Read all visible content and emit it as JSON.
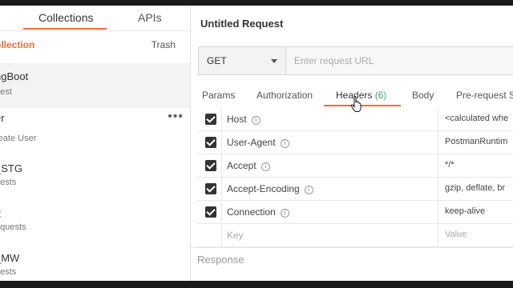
{
  "sidebar": {
    "tabs": [
      {
        "label": "Collections",
        "active": true
      },
      {
        "label": "APIs",
        "active": false
      }
    ],
    "new_collection_label": "ollection",
    "trash_label": "Trash",
    "items": [
      {
        "name": "ngBoot",
        "sub": "uest",
        "active": true
      },
      {
        "name": "er",
        "sub": "reate User",
        "active": false,
        "menu": "•••"
      },
      {
        "name": "_STG",
        "sub": "uests",
        "active": false
      },
      {
        "name": "2",
        "sub": "equests",
        "active": false
      },
      {
        "name": "_MW",
        "sub": "uests",
        "active": false
      }
    ]
  },
  "request": {
    "title": "Untitled Request",
    "method": "GET",
    "url_value": "",
    "url_placeholder": "Enter request URL",
    "tabs": [
      {
        "label": "Params"
      },
      {
        "label": "Authorization"
      },
      {
        "label": "Headers",
        "count": "(6)",
        "active": true
      },
      {
        "label": "Body"
      },
      {
        "label": "Pre-request S"
      }
    ],
    "headers": [
      {
        "key": "Host",
        "value": "<calculated whe",
        "checked": true
      },
      {
        "key": "User-Agent",
        "value": "PostmanRuntim",
        "checked": true
      },
      {
        "key": "Accept",
        "value": "*/*",
        "checked": true
      },
      {
        "key": "Accept-Encoding",
        "value": "gzip, deflate, br",
        "checked": true
      },
      {
        "key": "Connection",
        "value": "keep-alive",
        "checked": true
      }
    ],
    "new_row": {
      "key_placeholder": "Key",
      "value_placeholder": "Value"
    }
  },
  "response": {
    "label": "Response"
  },
  "colors": {
    "accent": "#f26b3a",
    "count": "#36a96b"
  }
}
